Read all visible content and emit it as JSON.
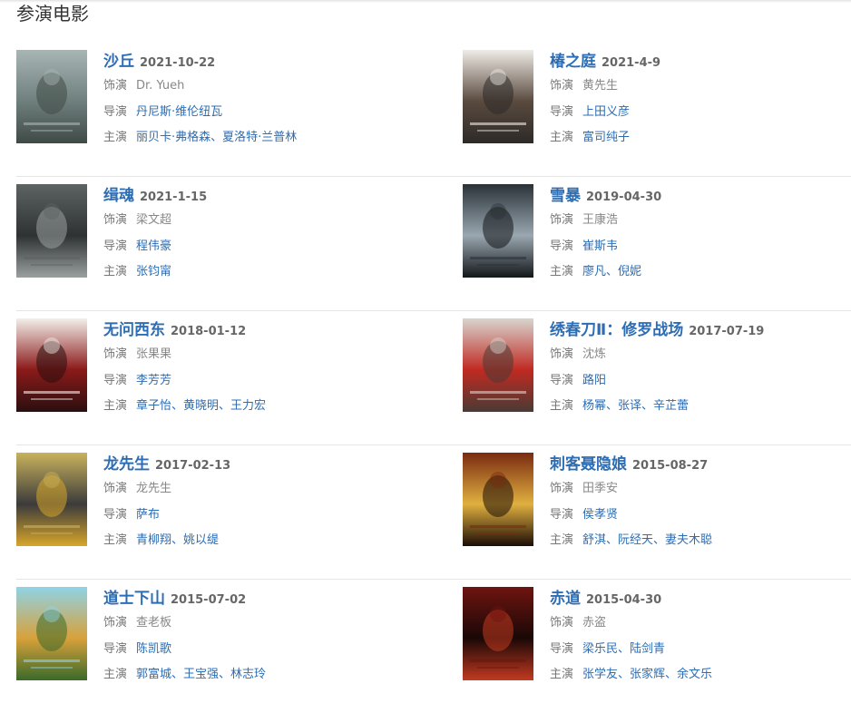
{
  "section": {
    "title": "参演电影"
  },
  "labels": {
    "role": "饰演",
    "director": "导演",
    "starring": "主演"
  },
  "movies": [
    {
      "title": "沙丘",
      "date": "2021-10-22",
      "role": "Dr. Yueh",
      "director": "丹尼斯·维伦纽瓦",
      "starring": "丽贝卡·弗格森、夏洛特·兰普林",
      "poster_colors": [
        "#a8b6b4",
        "#6e7f7d",
        "#3f4a46"
      ]
    },
    {
      "title": "椿之庭",
      "date": "2021-4-9",
      "role": "黄先生",
      "director": "上田义彦",
      "starring": "富司纯子",
      "poster_colors": [
        "#efece6",
        "#5a4a3f",
        "#2d2a28"
      ]
    },
    {
      "title": "缉魂",
      "date": "2021-1-15",
      "role": "梁文超",
      "director": "程伟豪",
      "starring": "张钧甯",
      "poster_colors": [
        "#5d6363",
        "#2e3232",
        "#9aa0a0"
      ]
    },
    {
      "title": "雪暴",
      "date": "2019-04-30",
      "role": "王康浩",
      "director": "崔斯韦",
      "starring": "廖凡、倪妮",
      "poster_colors": [
        "#2a3238",
        "#9aa7b0",
        "#121619"
      ]
    },
    {
      "title": "无问西东",
      "date": "2018-01-12",
      "role": "张果果",
      "director": "李芳芳",
      "starring": "章子怡、黄晓明、王力宏",
      "poster_colors": [
        "#f2efea",
        "#8b1a1a",
        "#2a0f0f"
      ]
    },
    {
      "title": "绣春刀Ⅱ：修罗战场",
      "date": "2017-07-19",
      "role": "沈炼",
      "director": "路阳",
      "starring": "杨幂、张译、辛芷蕾",
      "poster_colors": [
        "#d8d4cf",
        "#c02a22",
        "#4a3a34"
      ]
    },
    {
      "title": "龙先生",
      "date": "2017-02-13",
      "role": "龙先生",
      "director": "萨布",
      "starring": "青柳翔、姚以缇",
      "poster_colors": [
        "#c9b25c",
        "#3b3b3b",
        "#d7a52a"
      ]
    },
    {
      "title": "刺客聂隐娘",
      "date": "2015-08-27",
      "role": "田季安",
      "director": "侯孝贤",
      "starring": "舒淇、阮经天、妻夫木聪",
      "poster_colors": [
        "#7a2a10",
        "#e0b040",
        "#1c0c06"
      ]
    },
    {
      "title": "道士下山",
      "date": "2015-07-02",
      "role": "查老板",
      "director": "陈凯歌",
      "starring": "郭富城、王宝强、林志玲",
      "poster_colors": [
        "#8fd3e6",
        "#d8a13a",
        "#3a6a2a"
      ]
    },
    {
      "title": "赤道",
      "date": "2015-04-30",
      "role": "赤盗",
      "director": "梁乐民、陆剑青",
      "starring": "张学友、张家辉、余文乐",
      "poster_colors": [
        "#6e1410",
        "#1a0806",
        "#c23a20"
      ]
    }
  ]
}
